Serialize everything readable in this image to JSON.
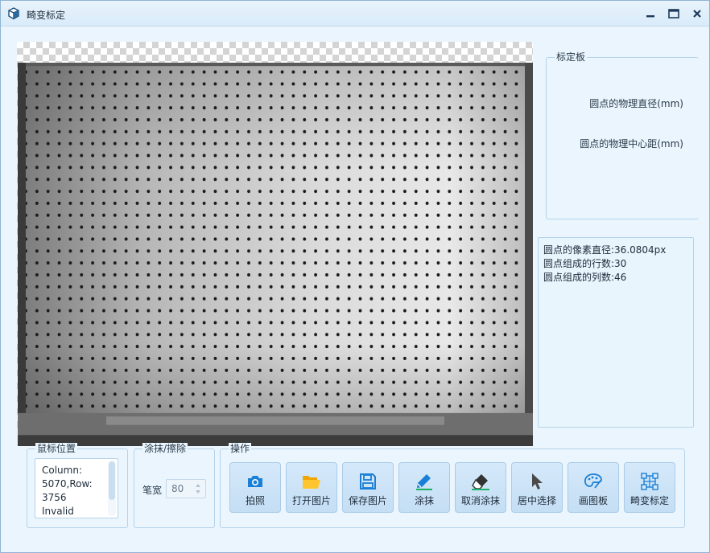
{
  "window": {
    "title": "畸变标定",
    "app_icon": "cube-icon",
    "controls": [
      "minimize-icon",
      "maximize-icon",
      "close-icon"
    ]
  },
  "calibration_board": {
    "group_title": "标定板",
    "dot_diameter_label": "圆点的物理直径(mm)",
    "dot_spacing_label": "圆点的物理中心距(mm)"
  },
  "result_info": {
    "lines": [
      "圆点的像素直径:36.0804px",
      "圆点组成的行数:30",
      "圆点组成的列数:46"
    ]
  },
  "mouse_position": {
    "group_title": "鼠标位置",
    "lines": [
      "Column:",
      "5070,Row:",
      "3756",
      "Invalid"
    ]
  },
  "paint_erase": {
    "group_title": "涂抹/擦除",
    "pen_width_label": "笔宽",
    "pen_width_value": "80"
  },
  "operations": {
    "group_title": "操作",
    "buttons": [
      {
        "label": "拍照",
        "icon": "camera-icon"
      },
      {
        "label": "打开图片",
        "icon": "folder-open-icon"
      },
      {
        "label": "保存图片",
        "icon": "save-icon"
      },
      {
        "label": "涂抹",
        "icon": "pen-icon"
      },
      {
        "label": "取消涂抹",
        "icon": "eraser-icon"
      },
      {
        "label": "居中选择",
        "icon": "cursor-arrow-icon"
      },
      {
        "label": "画图板",
        "icon": "palette-icon"
      },
      {
        "label": "畸变标定",
        "icon": "calibration-grid-icon"
      }
    ]
  },
  "colors": {
    "accent": "#1a7fd6",
    "button_bg": "#c8e0f5",
    "panel_border": "#b6d3ea",
    "window_bg": "#eaf5fd"
  }
}
